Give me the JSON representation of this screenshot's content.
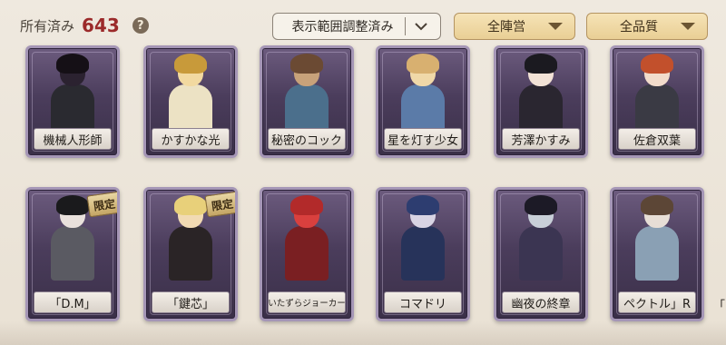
{
  "header": {
    "owned_label": "所有済み",
    "owned_count": "643",
    "help_icon": "?",
    "range_filter": "表示範囲調整済み",
    "camp_filter": "全陣営",
    "quality_filter": "全品質"
  },
  "cards": [
    {
      "name": "機械人形師",
      "limited": false
    },
    {
      "name": "かすかな光",
      "limited": false
    },
    {
      "name": "秘密のコック",
      "limited": false
    },
    {
      "name": "星を灯す少女",
      "limited": false
    },
    {
      "name": "芳澤かすみ",
      "limited": false
    },
    {
      "name": "佐倉双葉",
      "limited": false
    },
    {
      "name": "「D.M」",
      "limited": true
    },
    {
      "name": "「鍵芯」",
      "limited": true
    },
    {
      "name": "いたずらジョーカー",
      "limited": false
    },
    {
      "name": "コマドリ",
      "limited": false
    },
    {
      "name": "幽夜の終章",
      "limited": false
    },
    {
      "name": "ペクトル」R",
      "limited": false
    }
  ],
  "limited_label": "限定",
  "partial_next_label": "「",
  "colors": {
    "accent_red": "#9b2a2a",
    "card_frame": "#a596b6",
    "filter_gold": "#e9cf95"
  }
}
